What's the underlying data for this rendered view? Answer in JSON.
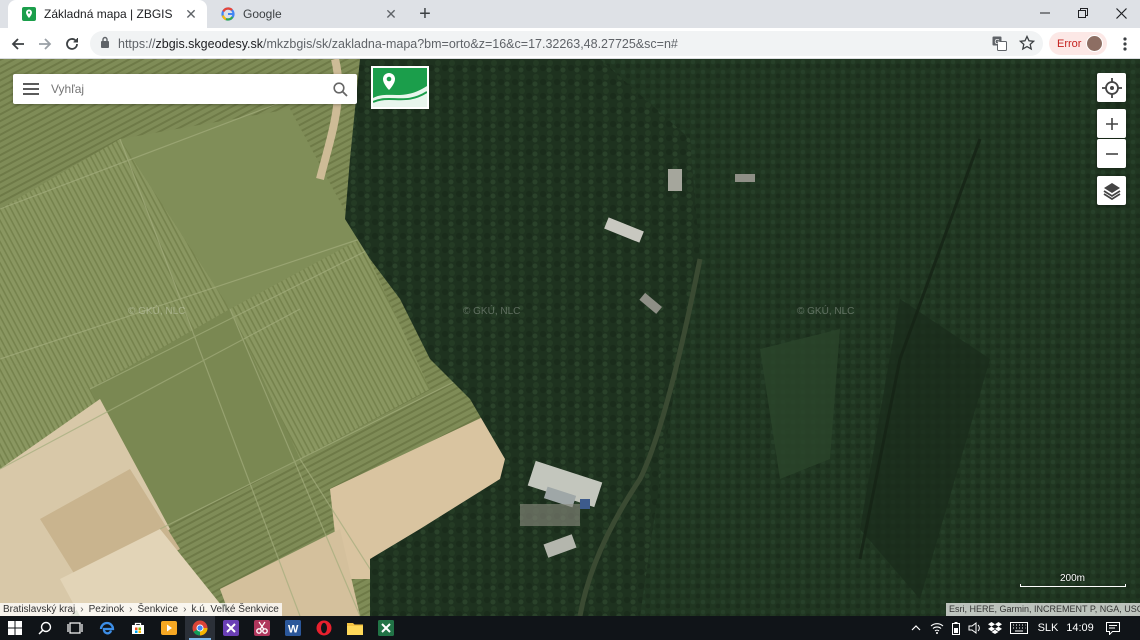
{
  "browser": {
    "tabs": [
      {
        "title": "Základná mapa | ZBGIS",
        "active": true,
        "icon": "zbgis-favicon"
      },
      {
        "title": "Google",
        "active": false,
        "icon": "google-favicon"
      }
    ],
    "url_host": "zbgis.skgeodesy.sk",
    "url_scheme": "https://",
    "url_path": "/mkzbgis/sk/zakladna-mapa?bm=orto&z=16&c=17.32263,48.27725&sc=n#",
    "error_label": "Error"
  },
  "map": {
    "search_placeholder": "Vyhľaj",
    "watermarks": [
      "© GKÚ, NLC",
      "© GKÚ, NLC",
      "© GKÚ, NLC"
    ],
    "scale_label": "200m",
    "breadcrumb": [
      "Bratislavský kraj",
      "Pezinok",
      "Šenkvice",
      "k.ú. Veľké Šenkvice"
    ],
    "attribution": "Esri, HERE, Garmin, INCREMENT P, NGA, USGS"
  },
  "taskbar": {
    "language": "SLK",
    "time": "14:09"
  },
  "colors": {
    "forest": "#1f3320",
    "fields": "#7d8a55",
    "zbgis_green": "#1b9e4b"
  }
}
